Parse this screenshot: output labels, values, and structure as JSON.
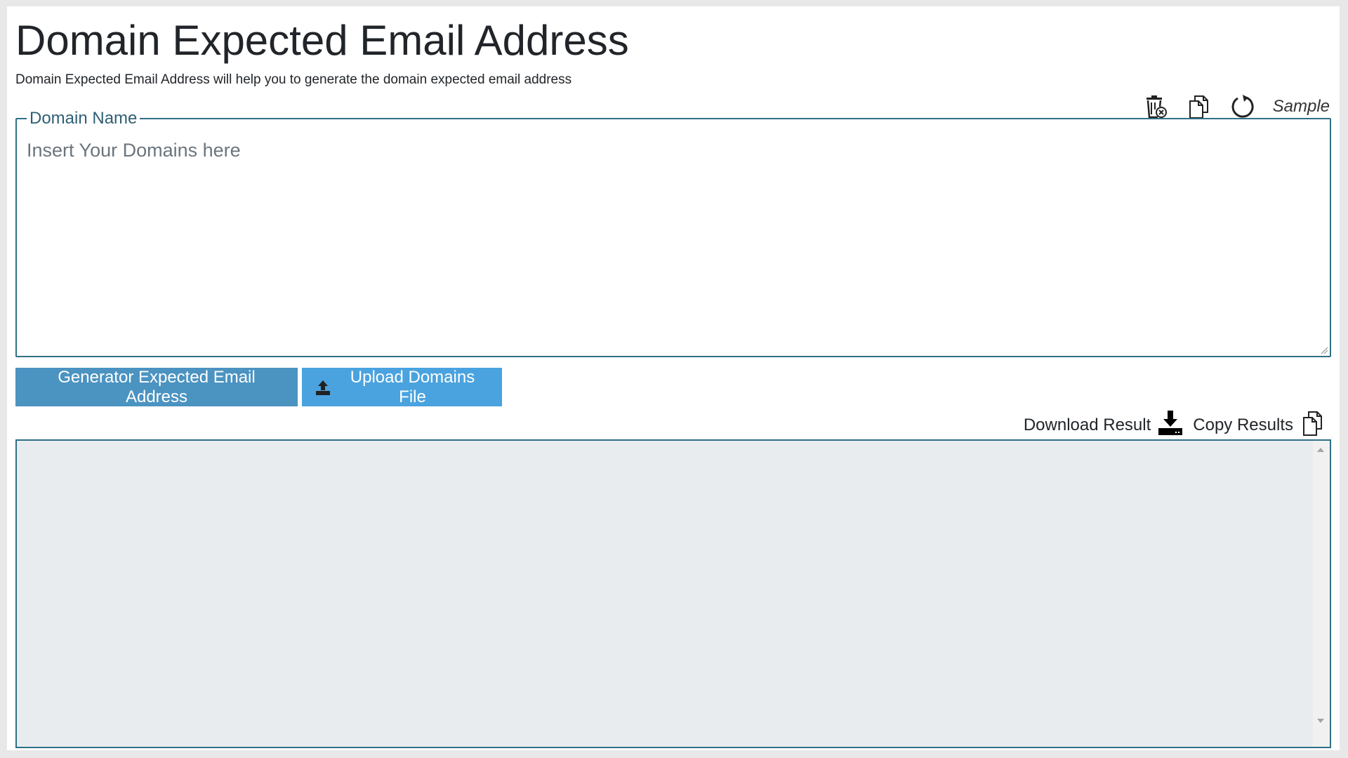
{
  "header": {
    "title": "Domain Expected Email Address",
    "subtitle": "Domain Expected Email Address will help you to generate the domain expected email address"
  },
  "toolbar": {
    "icons": [
      "clear-icon",
      "copy-icon",
      "reset-icon"
    ],
    "sample_label": "Sample"
  },
  "domain_input": {
    "legend": "Domain Name",
    "placeholder": "Insert Your Domains here",
    "value": ""
  },
  "actions": {
    "generate_label": "Generator Expected Email Address",
    "upload_label": "Upload Domains File"
  },
  "result": {
    "download_label": "Download Result",
    "copy_label": "Copy Results",
    "value": ""
  },
  "colors": {
    "generate_button": "#4b93c1",
    "upload_button": "#4aa3df",
    "border": "#2f6f86",
    "result_bg": "#e9ecef"
  }
}
